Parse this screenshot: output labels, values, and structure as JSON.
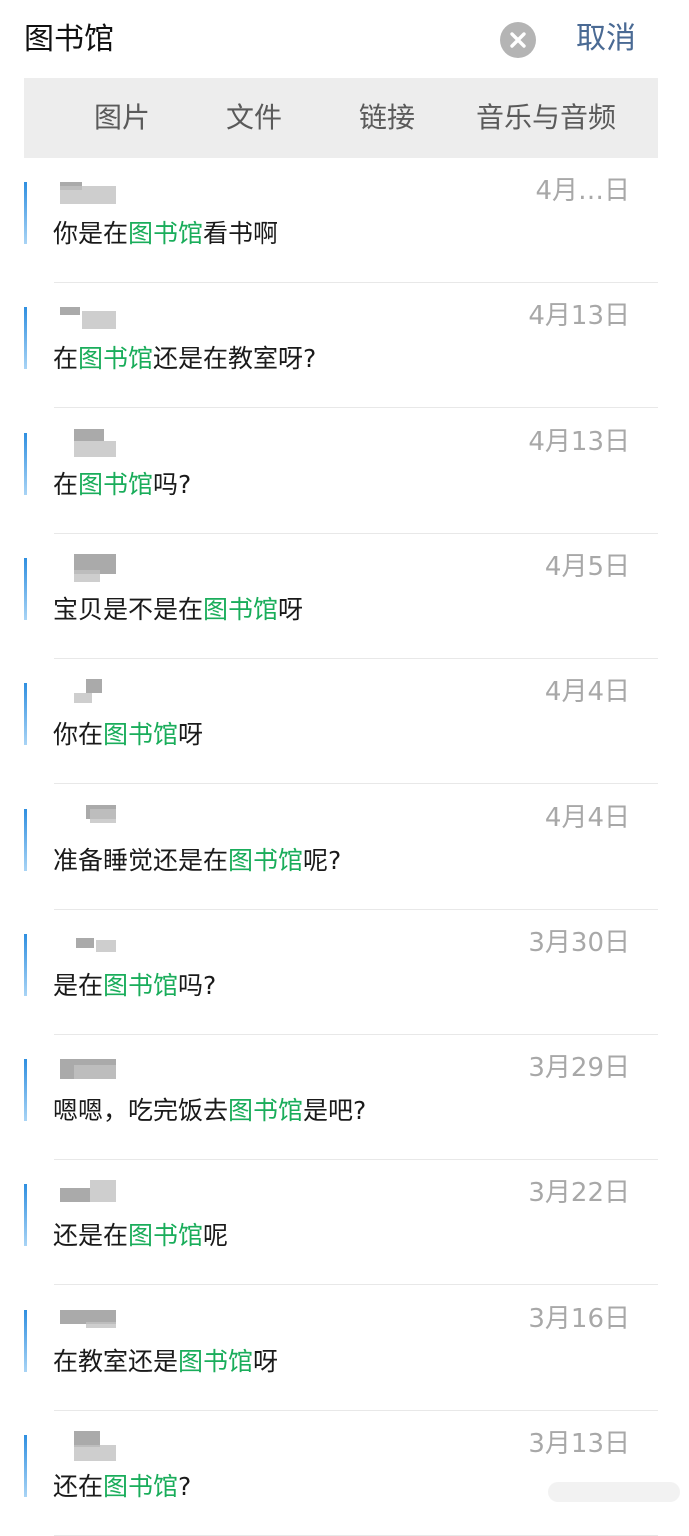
{
  "search": {
    "query": "图书馆",
    "cancel_label": "取消",
    "clear_icon": "clear-circle-icon"
  },
  "filters": {
    "tabs": [
      "图片",
      "文件",
      "链接",
      "音乐与音频"
    ]
  },
  "colors": {
    "highlight": "#1aad5b",
    "cancel": "#4a6a94",
    "date": "#a8a8a8",
    "filter_bg": "#ededed"
  },
  "results": [
    {
      "date": "4月…日",
      "before": "你是在",
      "match": "图书馆",
      "after": "看书啊"
    },
    {
      "date": "4月13日",
      "before": "在",
      "match": "图书馆",
      "after": "还是在教室呀?"
    },
    {
      "date": "4月13日",
      "before": "在",
      "match": "图书馆",
      "after": "吗?"
    },
    {
      "date": "4月5日",
      "before": "宝贝是不是在",
      "match": "图书馆",
      "after": "呀"
    },
    {
      "date": "4月4日",
      "before": "你在",
      "match": "图书馆",
      "after": "呀"
    },
    {
      "date": "4月4日",
      "before": "准备睡觉还是在",
      "match": "图书馆",
      "after": "呢?"
    },
    {
      "date": "3月30日",
      "before": "是在",
      "match": "图书馆",
      "after": "吗?"
    },
    {
      "date": "3月29日",
      "before": "嗯嗯，吃完饭去",
      "match": "图书馆",
      "after": "是吧?"
    },
    {
      "date": "3月22日",
      "before": "还是在",
      "match": "图书馆",
      "after": "呢"
    },
    {
      "date": "3月16日",
      "before": "在教室还是",
      "match": "图书馆",
      "after": "呀"
    },
    {
      "date": "3月13日",
      "before": "还在",
      "match": "图书馆",
      "after": "?"
    }
  ]
}
